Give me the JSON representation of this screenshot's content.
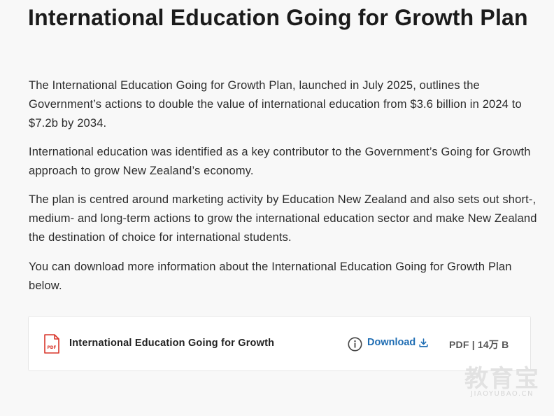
{
  "article": {
    "title": "International Education Going for Growth Plan",
    "paragraphs": [
      "The International Education Going for Growth Plan, launched in July 2025, outlines the Government’s actions to double the value of international education from $3.6 billion in 2024 to $7.2b by 2034.",
      "International education was identified as a key contributor to the Government’s Going for Growth approach to grow New Zealand’s economy.",
      "The plan is centred around marketing activity by Education New Zealand and also sets out short-, medium- and long-term actions to grow the international education sector and make New Zealand the destination of choice for international students.",
      "You can download more information about the International Education Going for Growth Plan below."
    ]
  },
  "download_card": {
    "file_icon": "pdf-file-icon",
    "file_icon_label": "PDF",
    "document_title": "International Education Going for Growth",
    "info_icon": "info-icon",
    "download_label": "Download",
    "download_icon": "download-icon",
    "file_meta": "PDF | 14万 B"
  },
  "watermark": {
    "main": "教育宝",
    "sub": "JIAOYUBAO.CN"
  },
  "colors": {
    "link": "#1f6db3",
    "pdf_red": "#d9362b"
  }
}
